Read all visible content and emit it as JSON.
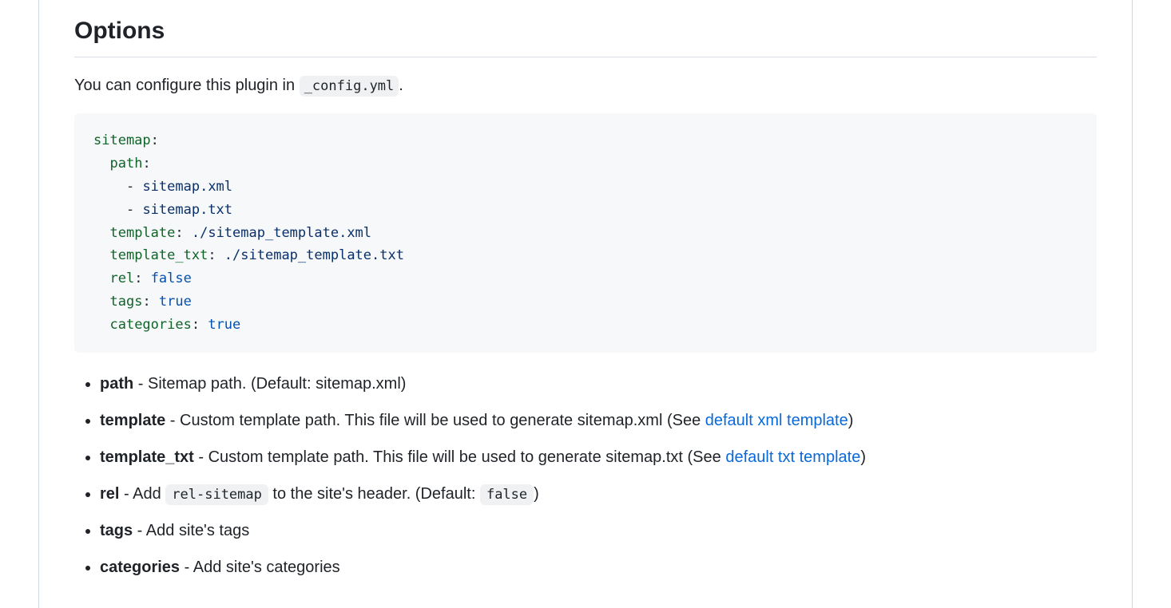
{
  "heading": "Options",
  "intro_prefix": "You can configure this plugin in ",
  "intro_code": "_config.yml",
  "intro_suffix": ".",
  "code": {
    "sitemap": "sitemap",
    "path": "path",
    "item1": "sitemap.xml",
    "item2": "sitemap.txt",
    "template_k": "template",
    "template_v": "./sitemap_template.xml",
    "template_txt_k": "template_txt",
    "template_txt_v": "./sitemap_template.txt",
    "rel_k": "rel",
    "rel_v": "false",
    "tags_k": "tags",
    "tags_v": "true",
    "categories_k": "categories",
    "categories_v": "true"
  },
  "li": {
    "path_k": "path",
    "path_t": " - Sitemap path. (Default: sitemap.xml)",
    "template_k": "template",
    "template_t": " - Custom template path. This file will be used to generate sitemap.xml (See ",
    "template_link": "default xml template",
    "template_close": ")",
    "template_txt_k": "template_txt",
    "template_txt_t": " - Custom template path. This file will be used to generate sitemap.txt (See ",
    "template_txt_link": "default txt template",
    "template_txt_close": ")",
    "rel_k": "rel",
    "rel_t1": " - Add ",
    "rel_code1": "rel-sitemap",
    "rel_t2": " to the site's header. (Default: ",
    "rel_code2": "false",
    "rel_close": ")",
    "tags_k": "tags",
    "tags_t": " - Add site's tags",
    "categories_k": "categories",
    "categories_t": " - Add site's categories"
  }
}
